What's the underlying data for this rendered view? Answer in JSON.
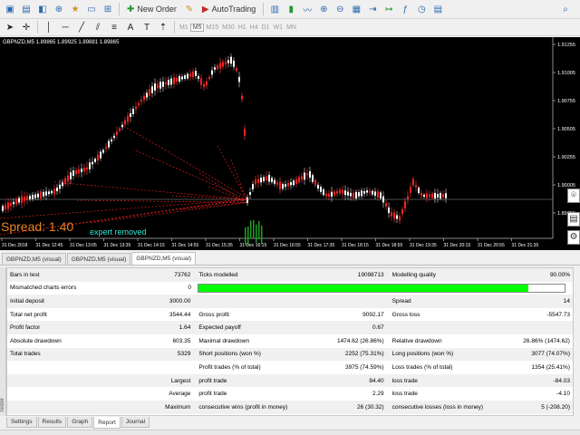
{
  "toolbar": {
    "new_order_label": "New Order",
    "autotrading_label": "AutoTrading",
    "timeframes": [
      "M1",
      "M5",
      "M15",
      "M30",
      "H1",
      "H4",
      "D1",
      "W1",
      "MN"
    ],
    "active_timeframe": "M5"
  },
  "chart": {
    "title": "GBPNZD,M5  1.89865 1.89925 1.89881 1.89865",
    "price_labels": [
      "1.91255",
      "1.91005",
      "1.90755",
      "1.90505",
      "1.90255",
      "1.90005",
      "1.89755"
    ],
    "time_labels": [
      "31 Dec 2018",
      "31 Dec 12:45",
      "31 Dec 13:05",
      "31 Dec 13:35",
      "31 Dec 14:15",
      "31 Dec 14:55",
      "31 Dec 15:35",
      "31 Dec 16:15",
      "31 Dec 16:55",
      "31 Dec 17:35",
      "31 Dec 18:15",
      "31 Dec 18:55",
      "31 Dec 19:35",
      "31 Dec 20:15",
      "31 Dec 20:55",
      "31 Dec 21:35"
    ],
    "spread_text": "Spread: 1.40",
    "status_text": "expert removed"
  },
  "chart_tabs": [
    "GBPNZD,M5 (visual)",
    "GBPNZD,M5 (visual)",
    "GBPNZD,M5 (visual)"
  ],
  "report": {
    "rows": [
      [
        "Bars in test",
        "73762",
        "Ticks modelled",
        "19098713",
        "Modelling quality",
        "90.00%"
      ],
      [
        "Mismatched charts errors",
        "0",
        "",
        "",
        "",
        ""
      ],
      [
        "Initial deposit",
        "3000.00",
        "",
        "",
        "Spread",
        "14"
      ],
      [
        "Total net profit",
        "3544.44",
        "Gross profit",
        "9092.17",
        "Gross loss",
        "-5547.73"
      ],
      [
        "Profit factor",
        "1.64",
        "Expected payoff",
        "0.67",
        "",
        ""
      ],
      [
        "Absolute drawdown",
        "603.35",
        "Maximal drawdown",
        "1474.62 (26.86%)",
        "Relative drawdown",
        "26.86% (1474.62)"
      ],
      [
        "Total trades",
        "5329",
        "Short positions (won %)",
        "2252 (75.31%)",
        "Long positions (won %)",
        "3077 (74.07%)"
      ],
      [
        "",
        "",
        "Profit trades (% of total)",
        "3975 (74.59%)",
        "Loss trades (% of total)",
        "1354 (25.41%)"
      ],
      [
        "",
        "Largest",
        "profit trade",
        "84.40",
        "loss trade",
        "-84.03"
      ],
      [
        "",
        "Average",
        "profit trade",
        "2.29",
        "loss trade",
        "-4.10"
      ],
      [
        "",
        "Maximum",
        "consecutive wins (profit in money)",
        "26 (30.32)",
        "consecutive losses (loss in money)",
        "5 (-208.20)"
      ]
    ],
    "modelling_quality_fraction": 0.9
  },
  "tester_label": "Tester",
  "bottom_tabs": [
    "Settings",
    "Results",
    "Graph",
    "Report",
    "Journal"
  ],
  "active_bottom_tab": "Report",
  "colors": {
    "chart_bg": "#000000",
    "bull_candle": "#ffffff",
    "bear_candle": "#ff2020",
    "trade_lines": "#ff2020",
    "spread_text": "#e6821e",
    "status_text": "#2fe8d5",
    "quality_bar": "#00ff00"
  }
}
